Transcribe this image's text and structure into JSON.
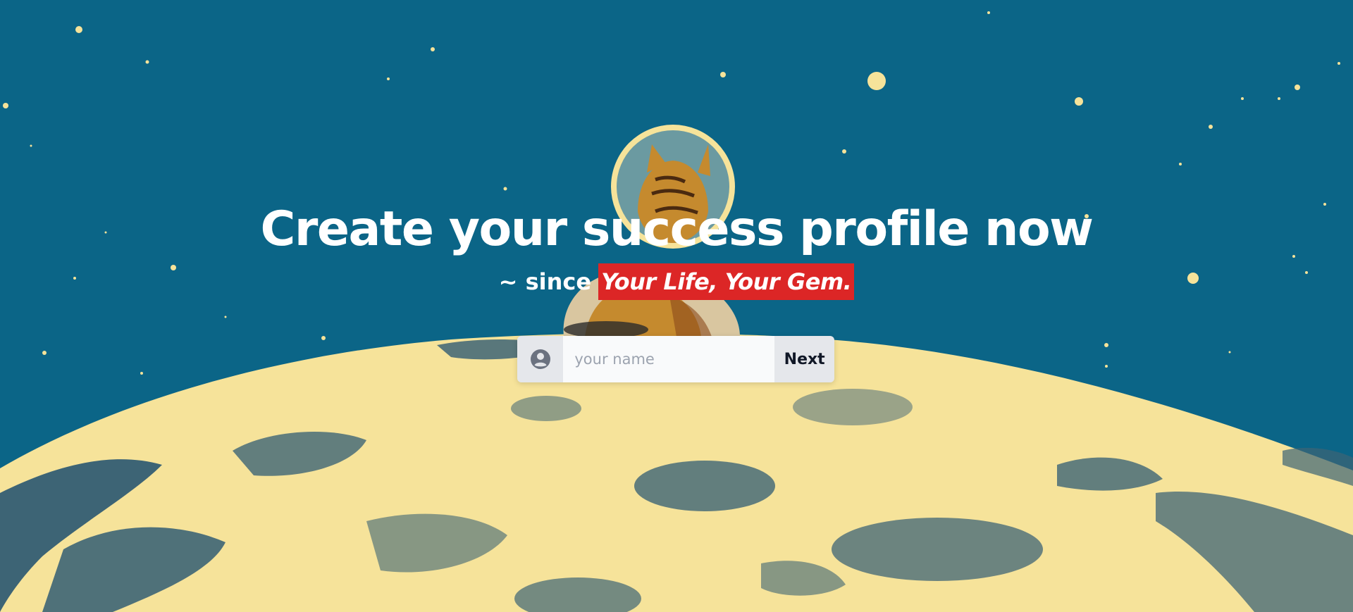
{
  "hero": {
    "headline": "Create your success profile now",
    "sub_prefix": "~ since",
    "sub_highlight": "Your Life, Your Gem."
  },
  "form": {
    "user_icon": "user-circle-icon",
    "name_placeholder": "your name",
    "name_value": "",
    "next_label": "Next"
  },
  "colors": {
    "sky": "#0b6587",
    "moon": "#f6e39a",
    "moon_shadow": "#3d6475",
    "highlight": "#dc2626",
    "star": "#f6e39a"
  }
}
